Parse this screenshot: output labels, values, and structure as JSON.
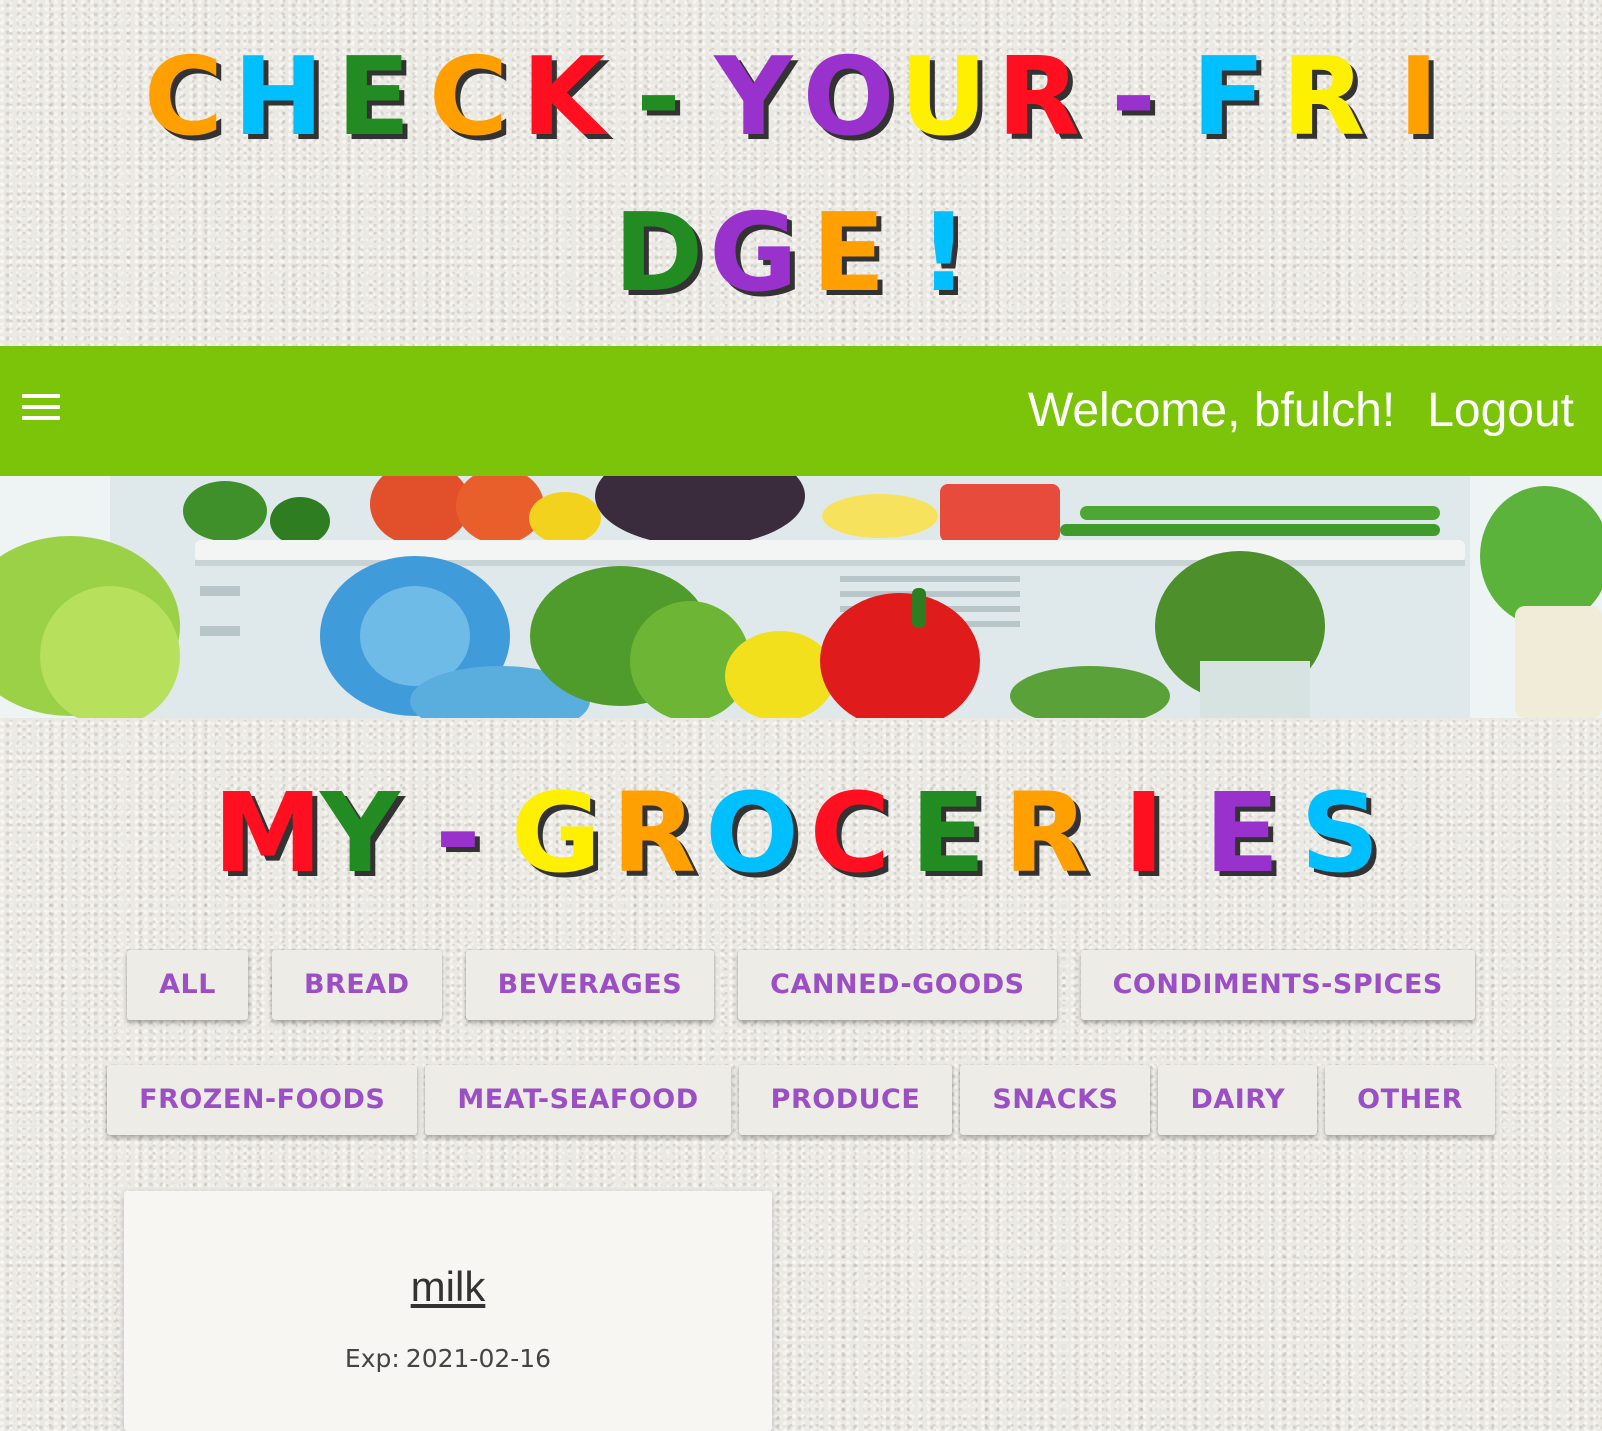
{
  "site": {
    "title_line1": [
      {
        "ch": "C",
        "color": "#ff9f00"
      },
      {
        "ch": "H",
        "color": "#00bfff"
      },
      {
        "ch": "E",
        "color": "#228b22"
      },
      {
        "ch": "C",
        "color": "#ff9f00"
      },
      {
        "ch": "K",
        "color": "#ff0f1f"
      },
      {
        "ch": "-",
        "color": "#228b22"
      },
      {
        "ch": "Y",
        "color": "#9932cc"
      },
      {
        "ch": "O",
        "color": "#9932cc"
      },
      {
        "ch": "U",
        "color": "#ffef00"
      },
      {
        "ch": "R",
        "color": "#ff0f1f"
      },
      {
        "ch": "-",
        "color": "#9932cc"
      },
      {
        "ch": "F",
        "color": "#00bfff"
      },
      {
        "ch": "R",
        "color": "#ffef00"
      },
      {
        "ch": "I",
        "color": "#ff9f00"
      }
    ],
    "title_line2": [
      {
        "ch": "D",
        "color": "#228b22"
      },
      {
        "ch": "G",
        "color": "#9932cc"
      },
      {
        "ch": "E",
        "color": "#ff9f00"
      },
      {
        "ch": "!",
        "color": "#00bfff"
      }
    ]
  },
  "navbar": {
    "menu_icon": "hamburger-menu-icon",
    "welcome_text": "Welcome, bfulch!",
    "logout_label": "Logout",
    "background_color": "#7bc40a"
  },
  "hero": {
    "image": "fridge-produce-banner"
  },
  "section_heading": [
    {
      "ch": "M",
      "color": "#ff0f1f"
    },
    {
      "ch": "Y",
      "color": "#228b22"
    },
    {
      "ch": "-",
      "color": "#9932cc"
    },
    {
      "ch": "G",
      "color": "#ffef00"
    },
    {
      "ch": "R",
      "color": "#ff9f00"
    },
    {
      "ch": "O",
      "color": "#00bfff"
    },
    {
      "ch": "C",
      "color": "#ff0f1f"
    },
    {
      "ch": "E",
      "color": "#228b22"
    },
    {
      "ch": "R",
      "color": "#ff9f00"
    },
    {
      "ch": "I",
      "color": "#ff0f1f"
    },
    {
      "ch": "E",
      "color": "#9932cc"
    },
    {
      "ch": "S",
      "color": "#00bfff"
    }
  ],
  "filters": {
    "row1": [
      "ALL",
      "BREAD",
      "BEVERAGES",
      "CANNED-GOODS",
      "CONDIMENTS-SPICES"
    ],
    "row2": [
      "FROZEN-FOODS",
      "MEAT-SEAFOOD",
      "PRODUCE",
      "SNACKS",
      "DAIRY",
      "OTHER"
    ],
    "text_color": "#9b4fc4"
  },
  "groceries": [
    {
      "name": "milk",
      "exp_label": "Exp:",
      "exp_date": "2021-02-16"
    }
  ]
}
